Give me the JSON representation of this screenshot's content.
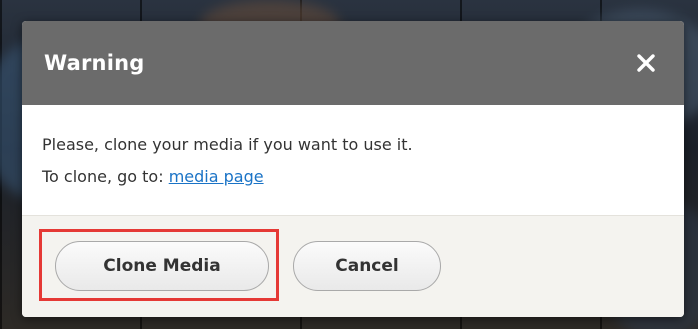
{
  "dialog": {
    "title": "Warning",
    "close_icon": "close-icon",
    "message_line1": "Please, clone your media if you want to use it.",
    "message_line2_prefix": "To clone, go to: ",
    "link_text": "media page",
    "buttons": {
      "clone": "Clone Media",
      "cancel": "Cancel"
    }
  },
  "colors": {
    "titlebar": "#6b6b6b",
    "link": "#1a73c6",
    "footer": "#f4f3ef",
    "highlight": "#e53935"
  }
}
